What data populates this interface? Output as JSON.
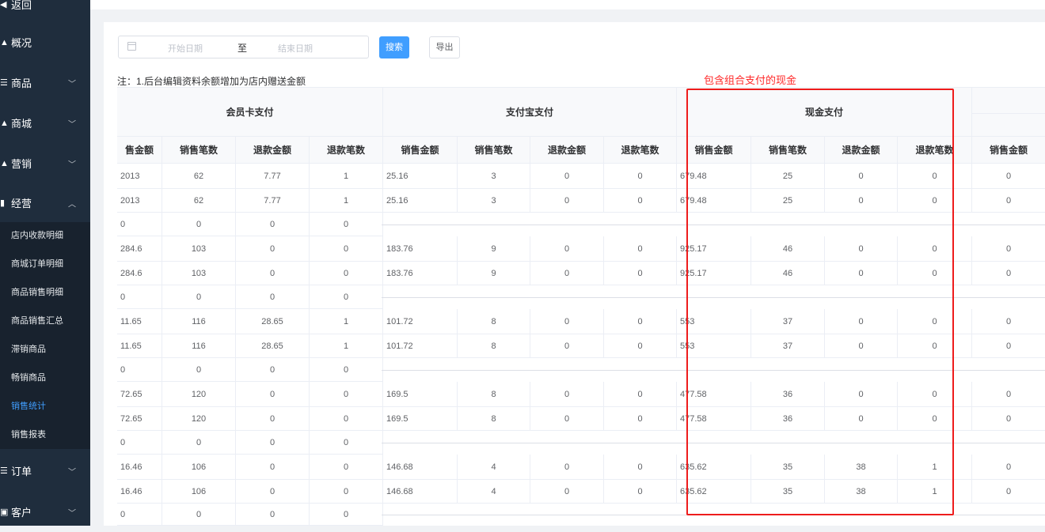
{
  "sidebar": {
    "items": [
      {
        "label": "返回",
        "icon": "back-icon",
        "has_chevron": false
      },
      {
        "label": "概况",
        "icon": "home-icon",
        "has_chevron": false
      },
      {
        "label": "商品",
        "icon": "list-icon",
        "has_chevron": true
      },
      {
        "label": "商城",
        "icon": "shop-icon",
        "has_chevron": true
      },
      {
        "label": "营销",
        "icon": "megaphone-icon",
        "has_chevron": true
      },
      {
        "label": "经营",
        "icon": "chart-icon",
        "has_chevron": true,
        "expanded": true
      },
      {
        "label": "订单",
        "icon": "list-icon",
        "has_chevron": true
      },
      {
        "label": "客户",
        "icon": "user-card-icon",
        "has_chevron": true
      }
    ],
    "submenu": [
      {
        "label": "店内收款明细"
      },
      {
        "label": "商城订单明细"
      },
      {
        "label": "商品销售明细"
      },
      {
        "label": "商品销售汇总"
      },
      {
        "label": "滞销商品"
      },
      {
        "label": "畅销商品"
      },
      {
        "label": "销售统计",
        "active": true
      },
      {
        "label": "销售报表"
      }
    ]
  },
  "toolbar": {
    "start_placeholder": "开始日期",
    "separator": "至",
    "end_placeholder": "结束日期",
    "search_label": "搜索",
    "export_label": "导出"
  },
  "note": "注：1.后台编辑资料余额增加为店内赠送金额",
  "annotation": "包含组合支付的现金",
  "table": {
    "groups": [
      "会员卡支付",
      "支付宝支付",
      "现金支付"
    ],
    "columns": [
      "售金额",
      "销售笔数",
      "退款金额",
      "退款笔数",
      "销售金额",
      "销售笔数",
      "退款金额",
      "退款笔数",
      "销售金额",
      "销售笔数",
      "退款金额",
      "退款笔数",
      "销售金额"
    ],
    "rows": [
      {
        "cells": [
          "2013",
          "62",
          "7.77",
          "1",
          "25.16",
          "3",
          "0",
          "0",
          "679.48",
          "25",
          "0",
          "0",
          "0"
        ]
      },
      {
        "cells": [
          "2013",
          "62",
          "7.77",
          "1",
          "25.16",
          "3",
          "0",
          "0",
          "679.48",
          "25",
          "0",
          "0",
          "0"
        ]
      },
      {
        "cells": [
          "0",
          "0",
          "0",
          "0"
        ]
      },
      {
        "cells": [
          "284.6",
          "103",
          "0",
          "0",
          "183.76",
          "9",
          "0",
          "0",
          "925.17",
          "46",
          "0",
          "0",
          "0"
        ]
      },
      {
        "cells": [
          "284.6",
          "103",
          "0",
          "0",
          "183.76",
          "9",
          "0",
          "0",
          "925.17",
          "46",
          "0",
          "0",
          "0"
        ]
      },
      {
        "cells": [
          "0",
          "0",
          "0",
          "0"
        ]
      },
      {
        "cells": [
          "11.65",
          "116",
          "28.65",
          "1",
          "101.72",
          "8",
          "0",
          "0",
          "553",
          "37",
          "0",
          "0",
          "0"
        ]
      },
      {
        "cells": [
          "11.65",
          "116",
          "28.65",
          "1",
          "101.72",
          "8",
          "0",
          "0",
          "553",
          "37",
          "0",
          "0",
          "0"
        ]
      },
      {
        "cells": [
          "0",
          "0",
          "0",
          "0"
        ]
      },
      {
        "cells": [
          "72.65",
          "120",
          "0",
          "0",
          "169.5",
          "8",
          "0",
          "0",
          "477.58",
          "36",
          "0",
          "0",
          "0"
        ]
      },
      {
        "cells": [
          "72.65",
          "120",
          "0",
          "0",
          "169.5",
          "8",
          "0",
          "0",
          "477.58",
          "36",
          "0",
          "0",
          "0"
        ]
      },
      {
        "cells": [
          "0",
          "0",
          "0",
          "0"
        ]
      },
      {
        "cells": [
          "16.46",
          "106",
          "0",
          "0",
          "146.68",
          "4",
          "0",
          "0",
          "635.62",
          "35",
          "38",
          "1",
          "0"
        ]
      },
      {
        "cells": [
          "16.46",
          "106",
          "0",
          "0",
          "146.68",
          "4",
          "0",
          "0",
          "635.62",
          "35",
          "38",
          "1",
          "0"
        ]
      },
      {
        "cells": [
          "0",
          "0",
          "0",
          "0"
        ]
      }
    ]
  },
  "colors": {
    "sidebar_bg": "#1f2d3d",
    "accent": "#409eff",
    "highlight": "#ee1c1c"
  }
}
